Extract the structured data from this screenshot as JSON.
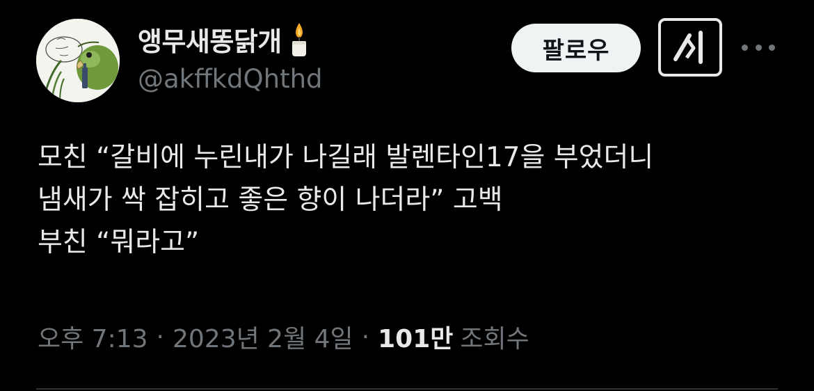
{
  "author": {
    "display_name": "앵무새똥닭개",
    "handle": "@akffkdQhthd",
    "avatar_icon": "parrot-sketch-avatar",
    "name_badge_icon": "candle-icon"
  },
  "actions": {
    "follow_label": "팔로우",
    "grok_icon": "grok-icon",
    "more_icon": "more-horizontal-icon"
  },
  "tweet": {
    "lines": [
      "모친 “갈비에 누린내가 나길래 발렌타인17을 부었더니",
      "냄새가 싹 잡히고 좋은 향이 나더라” 고백",
      "부친 “뭐라고”"
    ]
  },
  "meta": {
    "time": "오후 7:13",
    "separator": "·",
    "date": "2023년 2월 4일",
    "views_count": "101만",
    "views_label": "조회수"
  },
  "colors": {
    "background": "#000000",
    "primary_text": "#e7e9ea",
    "secondary_text": "#71767b",
    "follow_bg": "#eff3f4",
    "divider": "#2f3336"
  }
}
